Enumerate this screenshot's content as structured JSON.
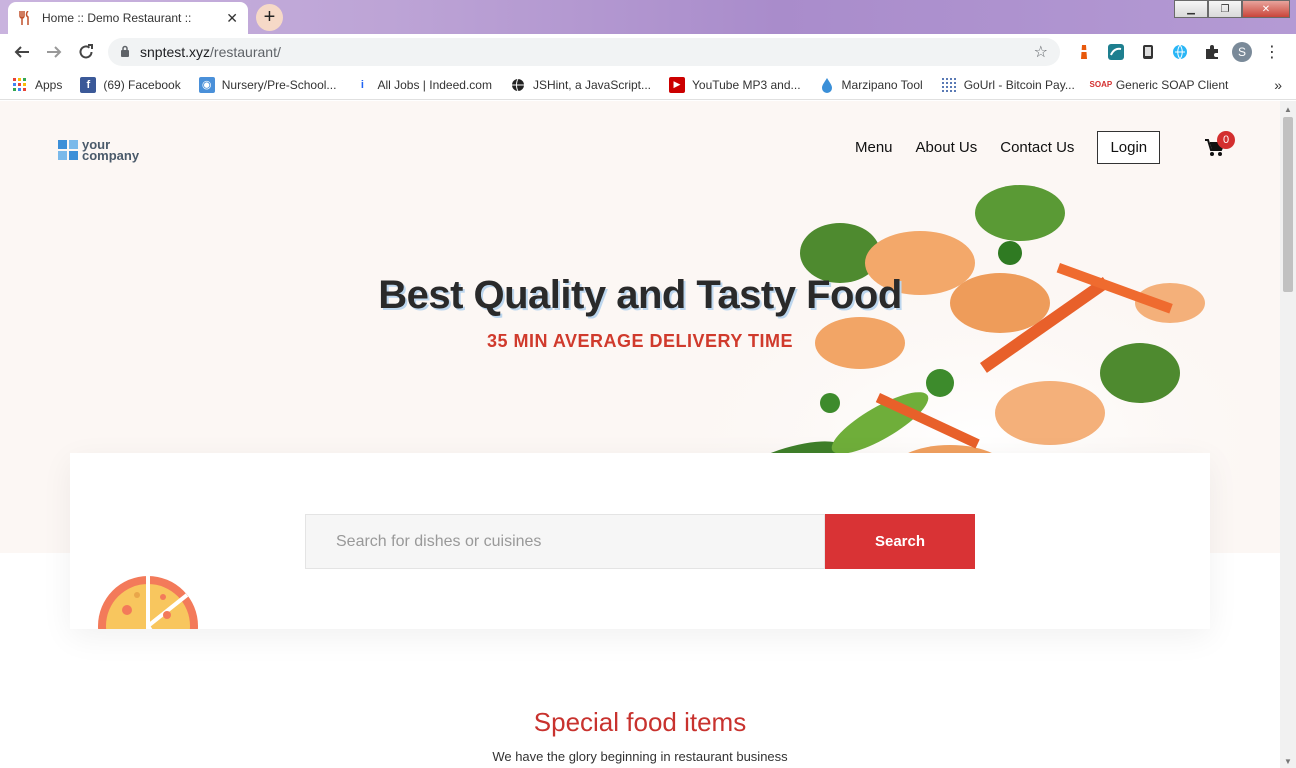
{
  "browser": {
    "tab_title": "Home :: Demo Restaurant ::",
    "tab_close": "✕",
    "new_tab": "+",
    "url_host": "snptest.xyz",
    "url_path": "/restaurant/",
    "profile_initial": "S"
  },
  "bookmarks": [
    {
      "label": "Apps",
      "icon": "apps-grid-icon",
      "color": "#4285f4"
    },
    {
      "label": "(69) Facebook",
      "icon": "facebook-icon",
      "color": "#3b5998"
    },
    {
      "label": "Nursery/Pre-School...",
      "icon": "chat-bubble-icon",
      "color": "#4a90d9"
    },
    {
      "label": "All Jobs | Indeed.com",
      "icon": "indeed-icon",
      "color": "#2164f3"
    },
    {
      "label": "JSHint, a JavaScript...",
      "icon": "globe-icon",
      "color": "#222222"
    },
    {
      "label": "YouTube MP3 and...",
      "icon": "play-icon",
      "color": "#cc0000"
    },
    {
      "label": "Marzipano Tool",
      "icon": "drop-icon",
      "color": "#3a8fd8"
    },
    {
      "label": "GoUrl - Bitcoin Pay...",
      "icon": "grid-icon",
      "color": "#5a7ab5"
    },
    {
      "label": "Generic SOAP Client",
      "icon": "soap-icon",
      "color": "#d32f2f"
    }
  ],
  "site": {
    "logo_line1": "your",
    "logo_line2": "company",
    "nav": {
      "menu": "Menu",
      "about": "About Us",
      "contact": "Contact Us",
      "login": "Login"
    },
    "cart_count": "0",
    "hero_title": "Best Quality and Tasty Food",
    "hero_subtitle": "35 MIN AVERAGE DELIVERY TIME",
    "search": {
      "placeholder": "Search for dishes or cuisines",
      "button": "Search"
    },
    "special_title": "Special food items",
    "special_subtitle": "We have the glory beginning in restaurant business"
  },
  "colors": {
    "accent_red": "#d93335",
    "hero_bg": "#fcf7f4",
    "title_text": "#2a2a2a"
  }
}
